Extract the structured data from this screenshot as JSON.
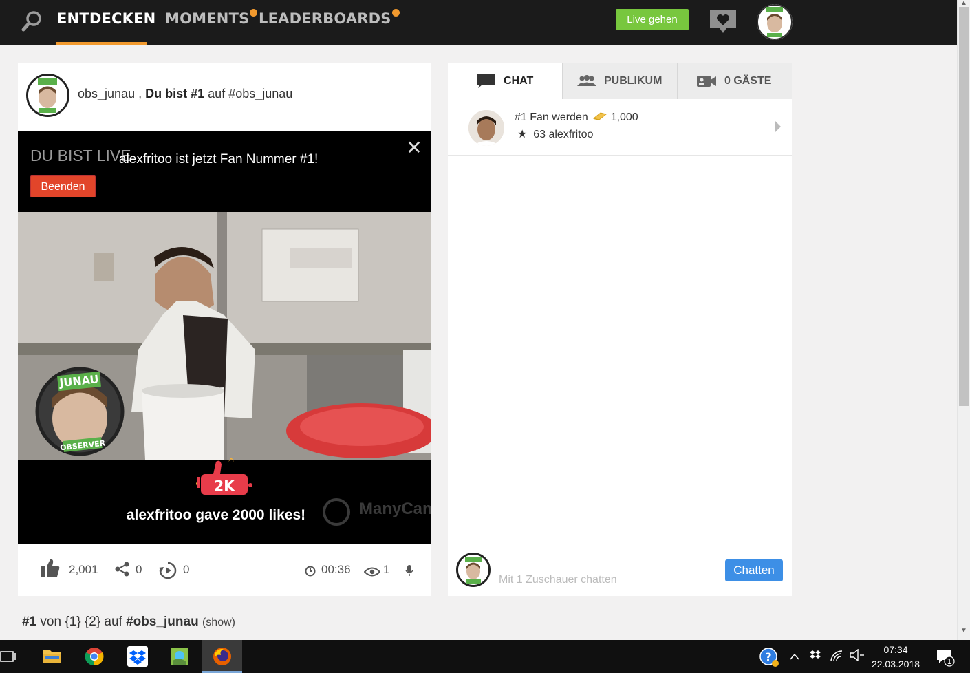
{
  "nav": {
    "tabs": [
      {
        "label": "ENTDECKEN",
        "active": true
      },
      {
        "label": "MOMENTS",
        "active": false,
        "badge_dot": true
      },
      {
        "label": "LEADERBOARDS",
        "active": false,
        "badge_dot": true
      }
    ],
    "live_button": "Live gehen",
    "icons": [
      "search-icon",
      "heart-chat-icon",
      "user-avatar"
    ],
    "accent_color": "#f29a2e",
    "live_color": "#78c73e"
  },
  "post": {
    "user": "obs_junau",
    "separator": ",",
    "rank_text": "Du bist #1",
    "on_text": "auf",
    "hashtag": "#obs_junau"
  },
  "video": {
    "live_label": "DU BIST LIVE",
    "fan_message": "alexfritoo ist jetzt Fan Nummer #1!",
    "end_button": "Beenden",
    "likes_badge": "2K",
    "likes_message": "alexfritoo gave 2000 likes!",
    "watermark": "ManyCam",
    "close_icon": "close-icon"
  },
  "stats": {
    "likes": "2,001",
    "shares": "0",
    "replays": "0",
    "duration": "00:36",
    "viewers": "1"
  },
  "below": {
    "rank": "#1",
    "von_text": "von {1} {2} auf",
    "hashtag": "#obs_junau",
    "show": "(show)"
  },
  "side": {
    "tabs": [
      {
        "label": "CHAT",
        "active": true,
        "icon": "chat-bubble-icon"
      },
      {
        "label": "PUBLIKUM",
        "active": false,
        "icon": "audience-icon"
      },
      {
        "label": "0 GÄSTE",
        "active": false,
        "icon": "video-camera-icon"
      }
    ],
    "fan": {
      "line1": "#1 Fan werden",
      "coins": "1,000",
      "star": "★",
      "line2": "63 alexfritoo"
    },
    "chat_placeholder": "Mit 1 Zuschauer chatten",
    "chat_button": "Chatten",
    "chat_button_color": "#3d8fe6"
  },
  "taskbar": {
    "apps": [
      "task-view-icon",
      "file-explorer-icon",
      "chrome-icon",
      "dropbox-icon",
      "maps-icon",
      "firefox-icon"
    ],
    "time": "07:34",
    "date": "22.03.2018",
    "notifications": "1"
  }
}
